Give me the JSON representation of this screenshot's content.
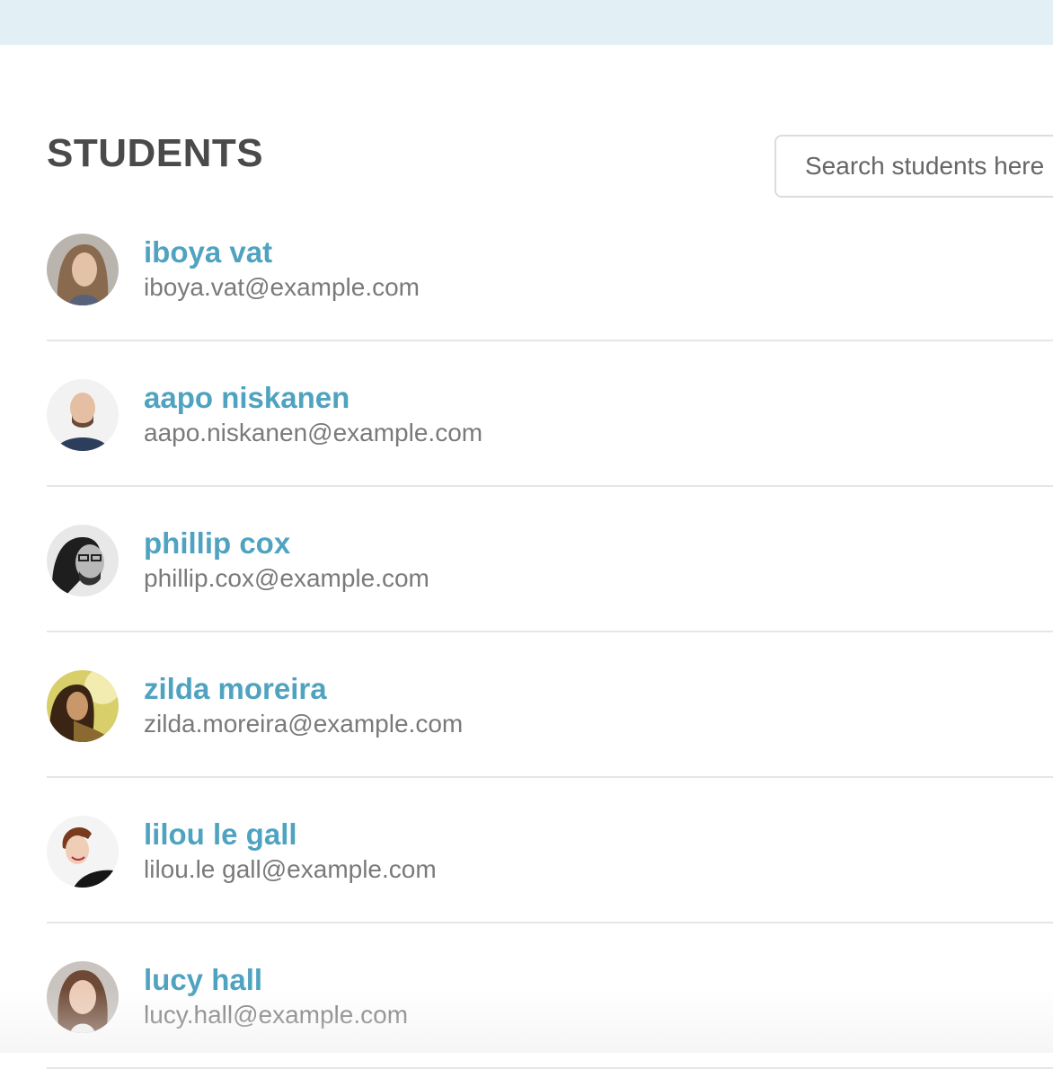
{
  "header": {
    "title": "STUDENTS"
  },
  "search": {
    "placeholder": "Search students here"
  },
  "students": [
    {
      "name": "iboya vat",
      "email": "iboya.vat@example.com",
      "avatar": "woman-portrait-1"
    },
    {
      "name": "aapo niskanen",
      "email": "aapo.niskanen@example.com",
      "avatar": "man-portrait-bald"
    },
    {
      "name": "phillip cox",
      "email": "phillip.cox@example.com",
      "avatar": "man-portrait-glasses-bw"
    },
    {
      "name": "zilda moreira",
      "email": "zilda.moreira@example.com",
      "avatar": "woman-portrait-2"
    },
    {
      "name": "lilou le gall",
      "email": "lilou.le gall@example.com",
      "avatar": "woman-portrait-3"
    },
    {
      "name": "lucy hall",
      "email": "lucy.hall@example.com",
      "avatar": "woman-portrait-4"
    }
  ],
  "colors": {
    "topbar": "#e2f0f6",
    "name_link": "#4fa3c0",
    "email_text": "#7a7a7a",
    "heading": "#4a4a4a"
  }
}
